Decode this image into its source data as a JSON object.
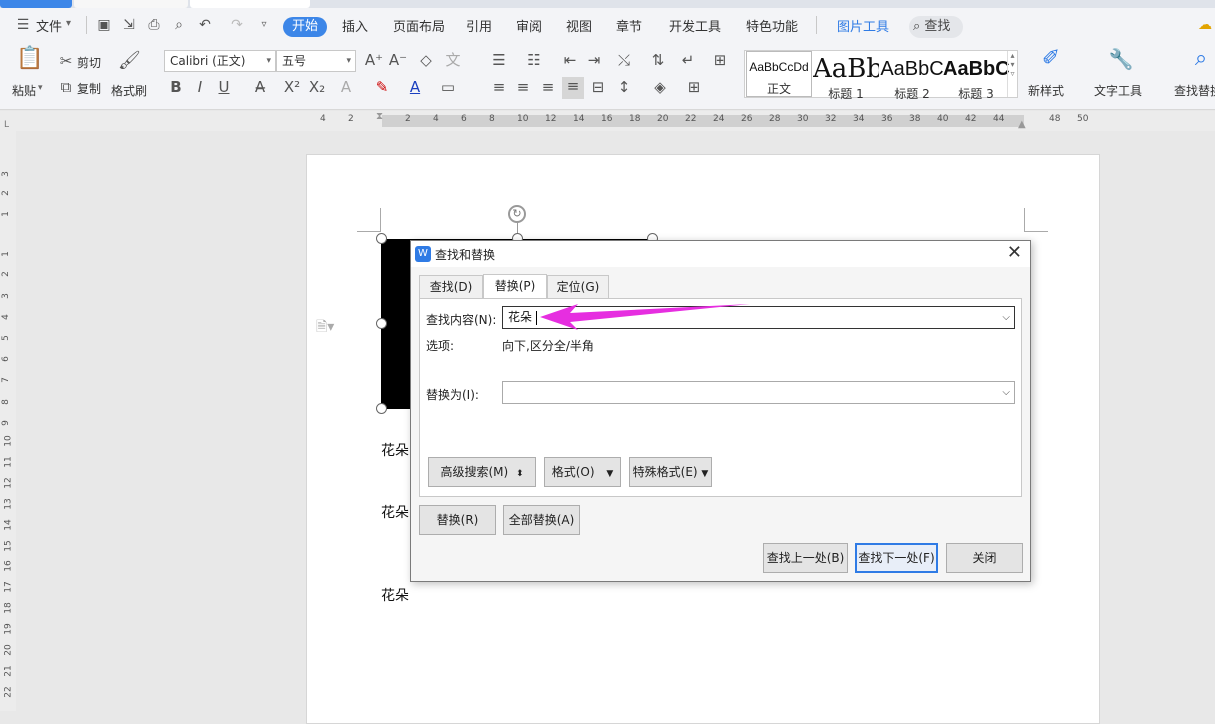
{
  "menu": {
    "file": "文件",
    "tabs": [
      "开始",
      "插入",
      "页面布局",
      "引用",
      "审阅",
      "视图",
      "章节",
      "开发工具",
      "特色功能"
    ],
    "picture_tools": "图片工具",
    "search": "查找"
  },
  "ribbon": {
    "paste": "粘贴",
    "cut": "剪切",
    "copy": "复制",
    "format_painter": "格式刷",
    "font_name": "Calibri (正文)",
    "font_size": "五号",
    "styles": [
      {
        "preview": "AaBbCcDd",
        "label": "正文"
      },
      {
        "preview": "AaBb",
        "label": "标题 1"
      },
      {
        "preview": "AaBbC",
        "label": "标题 2"
      },
      {
        "preview": "AaBbC",
        "label": "标题 3"
      }
    ],
    "new_style": "新样式",
    "text_tools": "文字工具",
    "find_replace": "查找替换"
  },
  "ruler": {
    "h_ticks": [
      "4",
      "2",
      "2",
      "4",
      "6",
      "8",
      "10",
      "12",
      "14",
      "16",
      "18",
      "20",
      "22",
      "24",
      "26",
      "28",
      "30",
      "32",
      "34",
      "36",
      "38",
      "40",
      "42",
      "44",
      "48",
      "50"
    ],
    "v_ticks": [
      "3",
      "2",
      "1",
      "1",
      "2",
      "3",
      "4",
      "5",
      "6",
      "7",
      "8",
      "9",
      "10",
      "11",
      "12",
      "13",
      "14",
      "15",
      "16",
      "17",
      "18",
      "19",
      "20",
      "21",
      "22"
    ]
  },
  "document": {
    "lines": [
      "花朵",
      "花朵",
      "花朵"
    ]
  },
  "dialog": {
    "title": "查找和替换",
    "tabs": [
      "查找(D)",
      "替换(P)",
      "定位(G)"
    ],
    "find_label": "查找内容(N):",
    "find_value": "花朵",
    "options_label": "选项:",
    "options_value": "向下,区分全/半角",
    "replace_label": "替换为(I):",
    "replace_value": "",
    "advanced_search": "高级搜索(M)",
    "format": "格式(O)",
    "special_format": "特殊格式(E)",
    "replace": "替换(R)",
    "replace_all": "全部替换(A)",
    "find_prev": "查找上一处(B)",
    "find_next": "查找下一处(F)",
    "close": "关闭"
  },
  "colors": {
    "accent": "#3c86e8",
    "arrow": "#e62ee0"
  }
}
